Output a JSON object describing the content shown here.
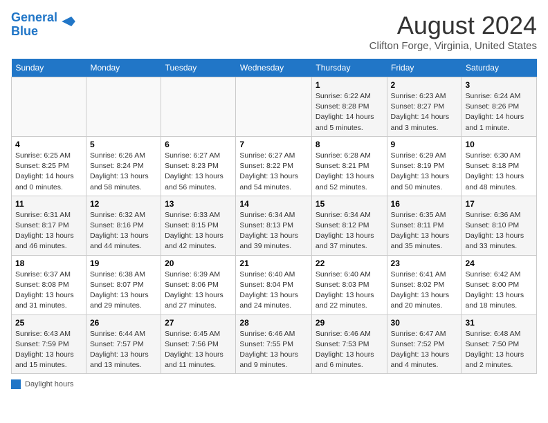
{
  "header": {
    "logo_line1": "General",
    "logo_line2": "Blue",
    "month": "August 2024",
    "location": "Clifton Forge, Virginia, United States"
  },
  "days_of_week": [
    "Sunday",
    "Monday",
    "Tuesday",
    "Wednesday",
    "Thursday",
    "Friday",
    "Saturday"
  ],
  "weeks": [
    [
      {
        "day": "",
        "info": ""
      },
      {
        "day": "",
        "info": ""
      },
      {
        "day": "",
        "info": ""
      },
      {
        "day": "",
        "info": ""
      },
      {
        "day": "1",
        "info": "Sunrise: 6:22 AM\nSunset: 8:28 PM\nDaylight: 14 hours\nand 5 minutes."
      },
      {
        "day": "2",
        "info": "Sunrise: 6:23 AM\nSunset: 8:27 PM\nDaylight: 14 hours\nand 3 minutes."
      },
      {
        "day": "3",
        "info": "Sunrise: 6:24 AM\nSunset: 8:26 PM\nDaylight: 14 hours\nand 1 minute."
      }
    ],
    [
      {
        "day": "4",
        "info": "Sunrise: 6:25 AM\nSunset: 8:25 PM\nDaylight: 14 hours\nand 0 minutes."
      },
      {
        "day": "5",
        "info": "Sunrise: 6:26 AM\nSunset: 8:24 PM\nDaylight: 13 hours\nand 58 minutes."
      },
      {
        "day": "6",
        "info": "Sunrise: 6:27 AM\nSunset: 8:23 PM\nDaylight: 13 hours\nand 56 minutes."
      },
      {
        "day": "7",
        "info": "Sunrise: 6:27 AM\nSunset: 8:22 PM\nDaylight: 13 hours\nand 54 minutes."
      },
      {
        "day": "8",
        "info": "Sunrise: 6:28 AM\nSunset: 8:21 PM\nDaylight: 13 hours\nand 52 minutes."
      },
      {
        "day": "9",
        "info": "Sunrise: 6:29 AM\nSunset: 8:19 PM\nDaylight: 13 hours\nand 50 minutes."
      },
      {
        "day": "10",
        "info": "Sunrise: 6:30 AM\nSunset: 8:18 PM\nDaylight: 13 hours\nand 48 minutes."
      }
    ],
    [
      {
        "day": "11",
        "info": "Sunrise: 6:31 AM\nSunset: 8:17 PM\nDaylight: 13 hours\nand 46 minutes."
      },
      {
        "day": "12",
        "info": "Sunrise: 6:32 AM\nSunset: 8:16 PM\nDaylight: 13 hours\nand 44 minutes."
      },
      {
        "day": "13",
        "info": "Sunrise: 6:33 AM\nSunset: 8:15 PM\nDaylight: 13 hours\nand 42 minutes."
      },
      {
        "day": "14",
        "info": "Sunrise: 6:34 AM\nSunset: 8:13 PM\nDaylight: 13 hours\nand 39 minutes."
      },
      {
        "day": "15",
        "info": "Sunrise: 6:34 AM\nSunset: 8:12 PM\nDaylight: 13 hours\nand 37 minutes."
      },
      {
        "day": "16",
        "info": "Sunrise: 6:35 AM\nSunset: 8:11 PM\nDaylight: 13 hours\nand 35 minutes."
      },
      {
        "day": "17",
        "info": "Sunrise: 6:36 AM\nSunset: 8:10 PM\nDaylight: 13 hours\nand 33 minutes."
      }
    ],
    [
      {
        "day": "18",
        "info": "Sunrise: 6:37 AM\nSunset: 8:08 PM\nDaylight: 13 hours\nand 31 minutes."
      },
      {
        "day": "19",
        "info": "Sunrise: 6:38 AM\nSunset: 8:07 PM\nDaylight: 13 hours\nand 29 minutes."
      },
      {
        "day": "20",
        "info": "Sunrise: 6:39 AM\nSunset: 8:06 PM\nDaylight: 13 hours\nand 27 minutes."
      },
      {
        "day": "21",
        "info": "Sunrise: 6:40 AM\nSunset: 8:04 PM\nDaylight: 13 hours\nand 24 minutes."
      },
      {
        "day": "22",
        "info": "Sunrise: 6:40 AM\nSunset: 8:03 PM\nDaylight: 13 hours\nand 22 minutes."
      },
      {
        "day": "23",
        "info": "Sunrise: 6:41 AM\nSunset: 8:02 PM\nDaylight: 13 hours\nand 20 minutes."
      },
      {
        "day": "24",
        "info": "Sunrise: 6:42 AM\nSunset: 8:00 PM\nDaylight: 13 hours\nand 18 minutes."
      }
    ],
    [
      {
        "day": "25",
        "info": "Sunrise: 6:43 AM\nSunset: 7:59 PM\nDaylight: 13 hours\nand 15 minutes."
      },
      {
        "day": "26",
        "info": "Sunrise: 6:44 AM\nSunset: 7:57 PM\nDaylight: 13 hours\nand 13 minutes."
      },
      {
        "day": "27",
        "info": "Sunrise: 6:45 AM\nSunset: 7:56 PM\nDaylight: 13 hours\nand 11 minutes."
      },
      {
        "day": "28",
        "info": "Sunrise: 6:46 AM\nSunset: 7:55 PM\nDaylight: 13 hours\nand 9 minutes."
      },
      {
        "day": "29",
        "info": "Sunrise: 6:46 AM\nSunset: 7:53 PM\nDaylight: 13 hours\nand 6 minutes."
      },
      {
        "day": "30",
        "info": "Sunrise: 6:47 AM\nSunset: 7:52 PM\nDaylight: 13 hours\nand 4 minutes."
      },
      {
        "day": "31",
        "info": "Sunrise: 6:48 AM\nSunset: 7:50 PM\nDaylight: 13 hours\nand 2 minutes."
      }
    ]
  ],
  "legend": {
    "label": "Daylight hours"
  }
}
